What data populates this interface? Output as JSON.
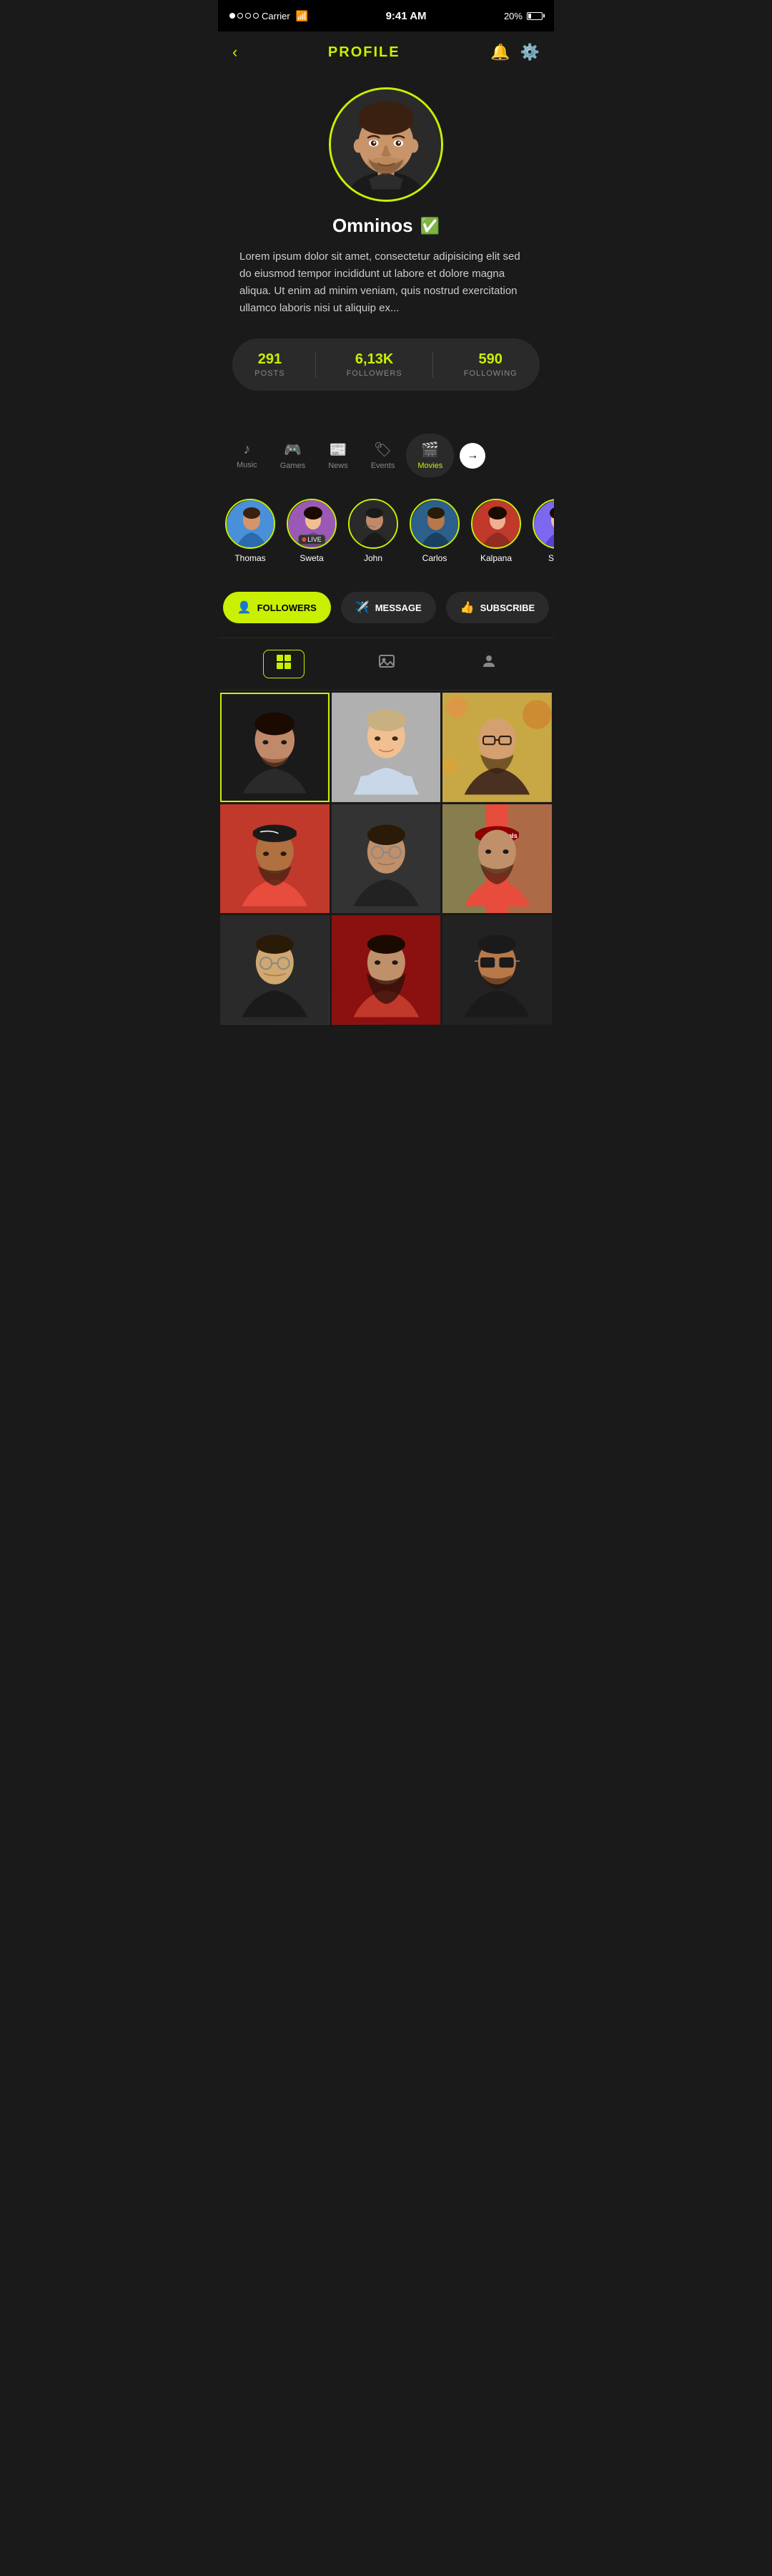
{
  "statusBar": {
    "carrier": "Carrier",
    "time": "9:41 AM",
    "battery": "20%"
  },
  "header": {
    "title": "PROFILE",
    "backLabel": "‹",
    "bellIcon": "🔔",
    "settingsIcon": "⚙"
  },
  "profile": {
    "username": "Omninos",
    "verified": true,
    "bio": "Lorem ipsum dolor sit amet, consectetur adipisicing elit sed do eiusmod tempor incididunt ut labore et dolore magna aliqua. Ut enim ad minim veniam, quis nostrud exercitation ullamco laboris nisi ut aliquip ex...",
    "stats": {
      "posts": {
        "value": "291",
        "label": "POSTS"
      },
      "followers": {
        "value": "6,13K",
        "label": "FOLLOWERS"
      },
      "following": {
        "value": "590",
        "label": "FOLLOWING"
      }
    }
  },
  "tabs": [
    {
      "id": "music",
      "icon": "♪",
      "label": "Music",
      "active": false
    },
    {
      "id": "games",
      "icon": "🎮",
      "label": "Games",
      "active": false
    },
    {
      "id": "news",
      "icon": "📰",
      "label": "News",
      "active": false
    },
    {
      "id": "events",
      "icon": "🏷",
      "label": "Events",
      "active": false
    },
    {
      "id": "movies",
      "icon": "🎬",
      "label": "Movies",
      "active": true
    }
  ],
  "arrowLabel": "→",
  "stories": [
    {
      "name": "Thomas",
      "live": false,
      "colorClass": "sa-1"
    },
    {
      "name": "Sweta",
      "live": true,
      "colorClass": "sa-2"
    },
    {
      "name": "John",
      "live": false,
      "colorClass": "sa-3"
    },
    {
      "name": "Carlos",
      "live": false,
      "colorClass": "sa-4"
    },
    {
      "name": "Kalpana",
      "live": false,
      "colorClass": "sa-5"
    },
    {
      "name": "Sw...",
      "live": false,
      "colorClass": "sa-6"
    }
  ],
  "actions": {
    "followers": {
      "label": "FOLLOWERS",
      "icon": "👤"
    },
    "message": {
      "label": "MESSAGE",
      "icon": "✈"
    },
    "subscribe": {
      "label": "SUBSCRIBE",
      "icon": "👍"
    }
  },
  "viewTabs": [
    {
      "id": "grid",
      "icon": "⊞",
      "active": true
    },
    {
      "id": "images",
      "icon": "🖼",
      "active": false
    },
    {
      "id": "person",
      "icon": "👤",
      "active": false
    }
  ],
  "photos": [
    {
      "id": 1,
      "colorClass": "photo-1",
      "selected": true
    },
    {
      "id": 2,
      "colorClass": "photo-2",
      "selected": false
    },
    {
      "id": 3,
      "colorClass": "photo-3",
      "selected": false
    },
    {
      "id": 4,
      "colorClass": "photo-4",
      "selected": false
    },
    {
      "id": 5,
      "colorClass": "photo-5",
      "selected": false
    },
    {
      "id": 6,
      "colorClass": "photo-6",
      "selected": false
    },
    {
      "id": 7,
      "colorClass": "photo-7",
      "selected": false
    },
    {
      "id": 8,
      "colorClass": "photo-8",
      "selected": false
    },
    {
      "id": 9,
      "colorClass": "photo-9",
      "selected": false
    }
  ],
  "liveBadge": "LIVE",
  "accentColor": "#c8f000"
}
